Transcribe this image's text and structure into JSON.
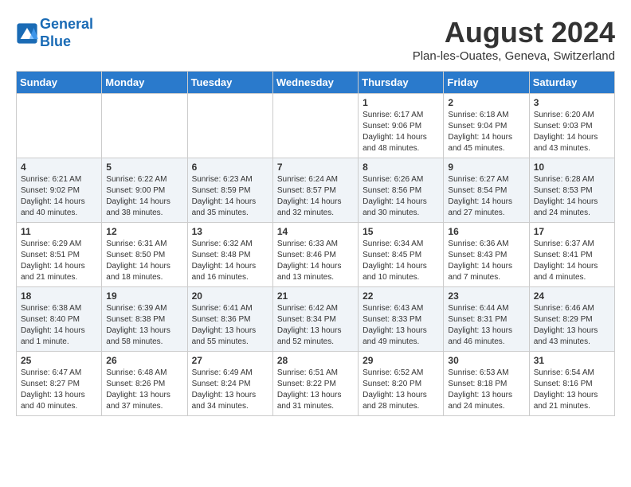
{
  "header": {
    "logo_line1": "General",
    "logo_line2": "Blue",
    "month_title": "August 2024",
    "location": "Plan-les-Ouates, Geneva, Switzerland"
  },
  "days_of_week": [
    "Sunday",
    "Monday",
    "Tuesday",
    "Wednesday",
    "Thursday",
    "Friday",
    "Saturday"
  ],
  "weeks": [
    [
      {
        "day": "",
        "info": ""
      },
      {
        "day": "",
        "info": ""
      },
      {
        "day": "",
        "info": ""
      },
      {
        "day": "",
        "info": ""
      },
      {
        "day": "1",
        "info": "Sunrise: 6:17 AM\nSunset: 9:06 PM\nDaylight: 14 hours\nand 48 minutes."
      },
      {
        "day": "2",
        "info": "Sunrise: 6:18 AM\nSunset: 9:04 PM\nDaylight: 14 hours\nand 45 minutes."
      },
      {
        "day": "3",
        "info": "Sunrise: 6:20 AM\nSunset: 9:03 PM\nDaylight: 14 hours\nand 43 minutes."
      }
    ],
    [
      {
        "day": "4",
        "info": "Sunrise: 6:21 AM\nSunset: 9:02 PM\nDaylight: 14 hours\nand 40 minutes."
      },
      {
        "day": "5",
        "info": "Sunrise: 6:22 AM\nSunset: 9:00 PM\nDaylight: 14 hours\nand 38 minutes."
      },
      {
        "day": "6",
        "info": "Sunrise: 6:23 AM\nSunset: 8:59 PM\nDaylight: 14 hours\nand 35 minutes."
      },
      {
        "day": "7",
        "info": "Sunrise: 6:24 AM\nSunset: 8:57 PM\nDaylight: 14 hours\nand 32 minutes."
      },
      {
        "day": "8",
        "info": "Sunrise: 6:26 AM\nSunset: 8:56 PM\nDaylight: 14 hours\nand 30 minutes."
      },
      {
        "day": "9",
        "info": "Sunrise: 6:27 AM\nSunset: 8:54 PM\nDaylight: 14 hours\nand 27 minutes."
      },
      {
        "day": "10",
        "info": "Sunrise: 6:28 AM\nSunset: 8:53 PM\nDaylight: 14 hours\nand 24 minutes."
      }
    ],
    [
      {
        "day": "11",
        "info": "Sunrise: 6:29 AM\nSunset: 8:51 PM\nDaylight: 14 hours\nand 21 minutes."
      },
      {
        "day": "12",
        "info": "Sunrise: 6:31 AM\nSunset: 8:50 PM\nDaylight: 14 hours\nand 18 minutes."
      },
      {
        "day": "13",
        "info": "Sunrise: 6:32 AM\nSunset: 8:48 PM\nDaylight: 14 hours\nand 16 minutes."
      },
      {
        "day": "14",
        "info": "Sunrise: 6:33 AM\nSunset: 8:46 PM\nDaylight: 14 hours\nand 13 minutes."
      },
      {
        "day": "15",
        "info": "Sunrise: 6:34 AM\nSunset: 8:45 PM\nDaylight: 14 hours\nand 10 minutes."
      },
      {
        "day": "16",
        "info": "Sunrise: 6:36 AM\nSunset: 8:43 PM\nDaylight: 14 hours\nand 7 minutes."
      },
      {
        "day": "17",
        "info": "Sunrise: 6:37 AM\nSunset: 8:41 PM\nDaylight: 14 hours\nand 4 minutes."
      }
    ],
    [
      {
        "day": "18",
        "info": "Sunrise: 6:38 AM\nSunset: 8:40 PM\nDaylight: 14 hours\nand 1 minute."
      },
      {
        "day": "19",
        "info": "Sunrise: 6:39 AM\nSunset: 8:38 PM\nDaylight: 13 hours\nand 58 minutes."
      },
      {
        "day": "20",
        "info": "Sunrise: 6:41 AM\nSunset: 8:36 PM\nDaylight: 13 hours\nand 55 minutes."
      },
      {
        "day": "21",
        "info": "Sunrise: 6:42 AM\nSunset: 8:34 PM\nDaylight: 13 hours\nand 52 minutes."
      },
      {
        "day": "22",
        "info": "Sunrise: 6:43 AM\nSunset: 8:33 PM\nDaylight: 13 hours\nand 49 minutes."
      },
      {
        "day": "23",
        "info": "Sunrise: 6:44 AM\nSunset: 8:31 PM\nDaylight: 13 hours\nand 46 minutes."
      },
      {
        "day": "24",
        "info": "Sunrise: 6:46 AM\nSunset: 8:29 PM\nDaylight: 13 hours\nand 43 minutes."
      }
    ],
    [
      {
        "day": "25",
        "info": "Sunrise: 6:47 AM\nSunset: 8:27 PM\nDaylight: 13 hours\nand 40 minutes."
      },
      {
        "day": "26",
        "info": "Sunrise: 6:48 AM\nSunset: 8:26 PM\nDaylight: 13 hours\nand 37 minutes."
      },
      {
        "day": "27",
        "info": "Sunrise: 6:49 AM\nSunset: 8:24 PM\nDaylight: 13 hours\nand 34 minutes."
      },
      {
        "day": "28",
        "info": "Sunrise: 6:51 AM\nSunset: 8:22 PM\nDaylight: 13 hours\nand 31 minutes."
      },
      {
        "day": "29",
        "info": "Sunrise: 6:52 AM\nSunset: 8:20 PM\nDaylight: 13 hours\nand 28 minutes."
      },
      {
        "day": "30",
        "info": "Sunrise: 6:53 AM\nSunset: 8:18 PM\nDaylight: 13 hours\nand 24 minutes."
      },
      {
        "day": "31",
        "info": "Sunrise: 6:54 AM\nSunset: 8:16 PM\nDaylight: 13 hours\nand 21 minutes."
      }
    ]
  ]
}
